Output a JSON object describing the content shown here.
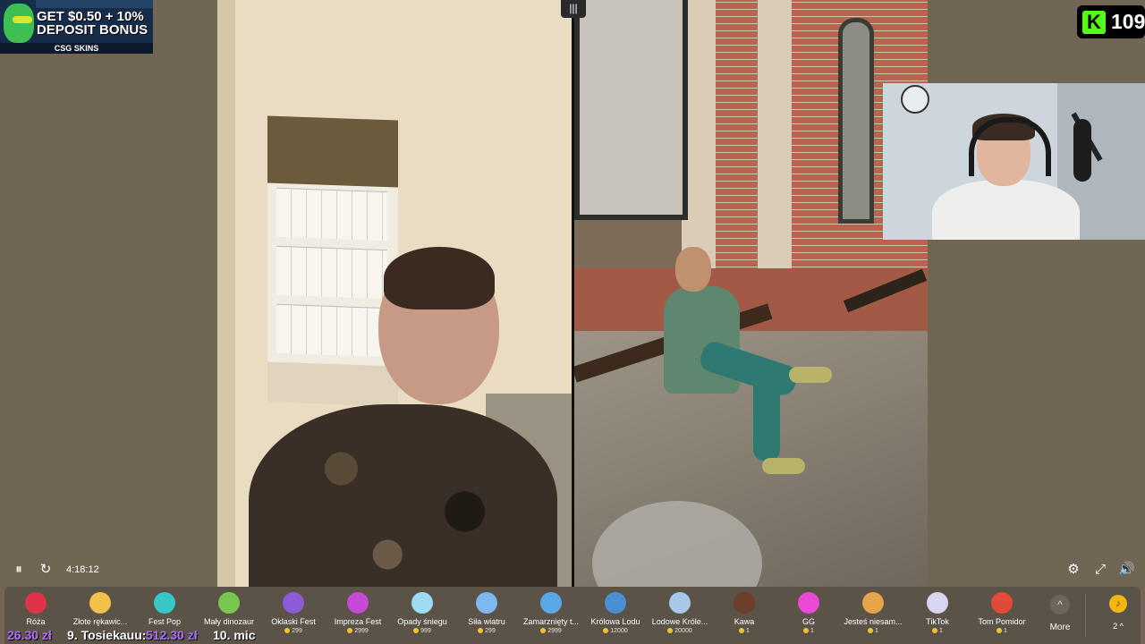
{
  "ad": {
    "line1": "GET $0.50 + 10%",
    "line2": "DEPOSIT BONUS",
    "brand": "CSG SKINS"
  },
  "viewers": {
    "logo_glyph": "K",
    "count": "109"
  },
  "layout_icon": "|||",
  "player": {
    "pause_icon": "⏸",
    "refresh_icon": "↻",
    "time": "4:18:12",
    "settings_icon": "⚙",
    "fullscreen_icon": "⤢",
    "volume_icon": "🔊"
  },
  "gifts": [
    {
      "name": "Róża",
      "price": "",
      "color": "#e0334a"
    },
    {
      "name": "Złote rękawic...",
      "price": "",
      "color": "#f0c24a"
    },
    {
      "name": "Fest Pop",
      "price": "",
      "color": "#37c7c7"
    },
    {
      "name": "Mały dinozaur",
      "price": "",
      "color": "#7ac74f"
    },
    {
      "name": "Oklaski Fest",
      "price": "299",
      "color": "#8e5bd6"
    },
    {
      "name": "Impreza Fest",
      "price": "2999",
      "color": "#c74ad6"
    },
    {
      "name": "Opady śniegu",
      "price": "999",
      "color": "#9edcf5"
    },
    {
      "name": "Siła wiatru",
      "price": "299",
      "color": "#7eb8f0"
    },
    {
      "name": "Zamarznięty t...",
      "price": "2999",
      "color": "#5aa8e8"
    },
    {
      "name": "Królowa Lodu",
      "price": "12000",
      "color": "#4a8fd6"
    },
    {
      "name": "Lodowe Króle...",
      "price": "20000",
      "color": "#a7c8e8"
    },
    {
      "name": "Kawa",
      "price": "1",
      "color": "#6b3f2a"
    },
    {
      "name": "GG",
      "price": "1",
      "color": "#e84ad6"
    },
    {
      "name": "Jesteś niesam...",
      "price": "1",
      "color": "#e8a44a"
    },
    {
      "name": "TikTok",
      "price": "1",
      "color": "#d6d6f0"
    },
    {
      "name": "Tom Pomidor",
      "price": "1",
      "color": "#e04a3a"
    }
  ],
  "more": {
    "icon": "^",
    "label": "More"
  },
  "tokens": {
    "icon": "♪",
    "count": "2 ^"
  },
  "ticker": {
    "amount1": "26.30 zł",
    "entry9_name": "9. Tosiekauu:",
    "entry9_amount": "512.30 zł",
    "entry10_name": "10. mic"
  }
}
